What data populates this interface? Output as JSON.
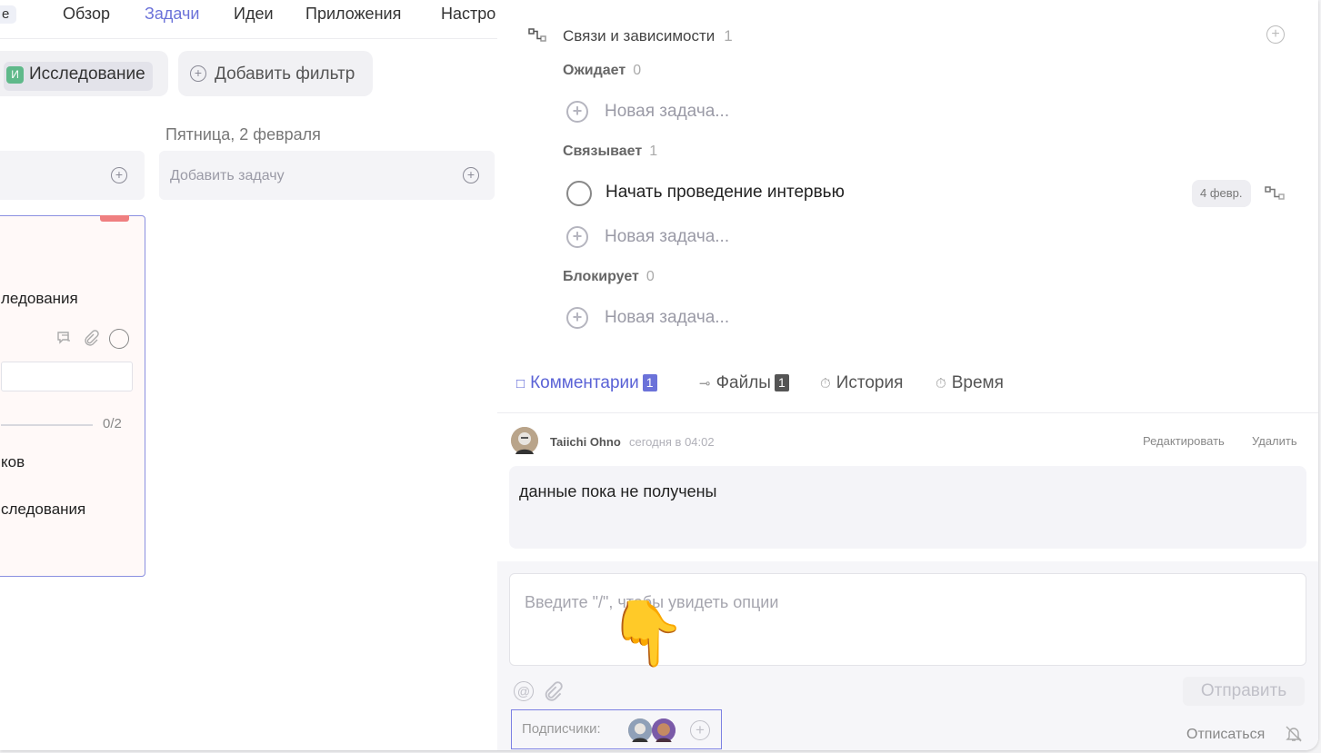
{
  "nav": {
    "partial": "е",
    "items": [
      "Обзор",
      "Задачи",
      "Идеи",
      "Приложения",
      "Настро"
    ],
    "active_index": 1
  },
  "filters": {
    "tag_letter": "И",
    "tag_label": "Исследование",
    "add_filter": "Добавить фильтр"
  },
  "board": {
    "column_title": "Пятница, 2 февраля",
    "add_task_placeholder": "Добавить задачу",
    "card": {
      "line1": "ледования",
      "progress": "0/2",
      "line2": "ков",
      "line3": "следования"
    }
  },
  "relations": {
    "title": "Связи и зависимости",
    "count": "1",
    "sections": [
      {
        "label": "Ожидает",
        "count": "0"
      },
      {
        "label": "Связывает",
        "count": "1"
      },
      {
        "label": "Блокирует",
        "count": "0"
      }
    ],
    "new_task": "Новая задача...",
    "linked_task": "Начать проведение интервью",
    "linked_date": "4 февр."
  },
  "tabs": [
    {
      "label": "Комментарии",
      "badge": "1"
    },
    {
      "label": "Файлы",
      "badge": "1"
    },
    {
      "label": "История"
    },
    {
      "label": "Время"
    }
  ],
  "comment": {
    "author": "Taiichi Ohno",
    "time": "сегодня в 04:02",
    "edit": "Редактировать",
    "delete": "Удалить",
    "text": "данные пока не получены"
  },
  "composer": {
    "placeholder": "Введите \"/\", чтобы увидеть опции",
    "send": "Отправить",
    "subscribers_label": "Подписчики:",
    "unsubscribe": "Отписаться"
  },
  "pointer_emoji": "👇",
  "colors": {
    "accent": "#6b72d9",
    "tag_green": "#5fb98a"
  }
}
